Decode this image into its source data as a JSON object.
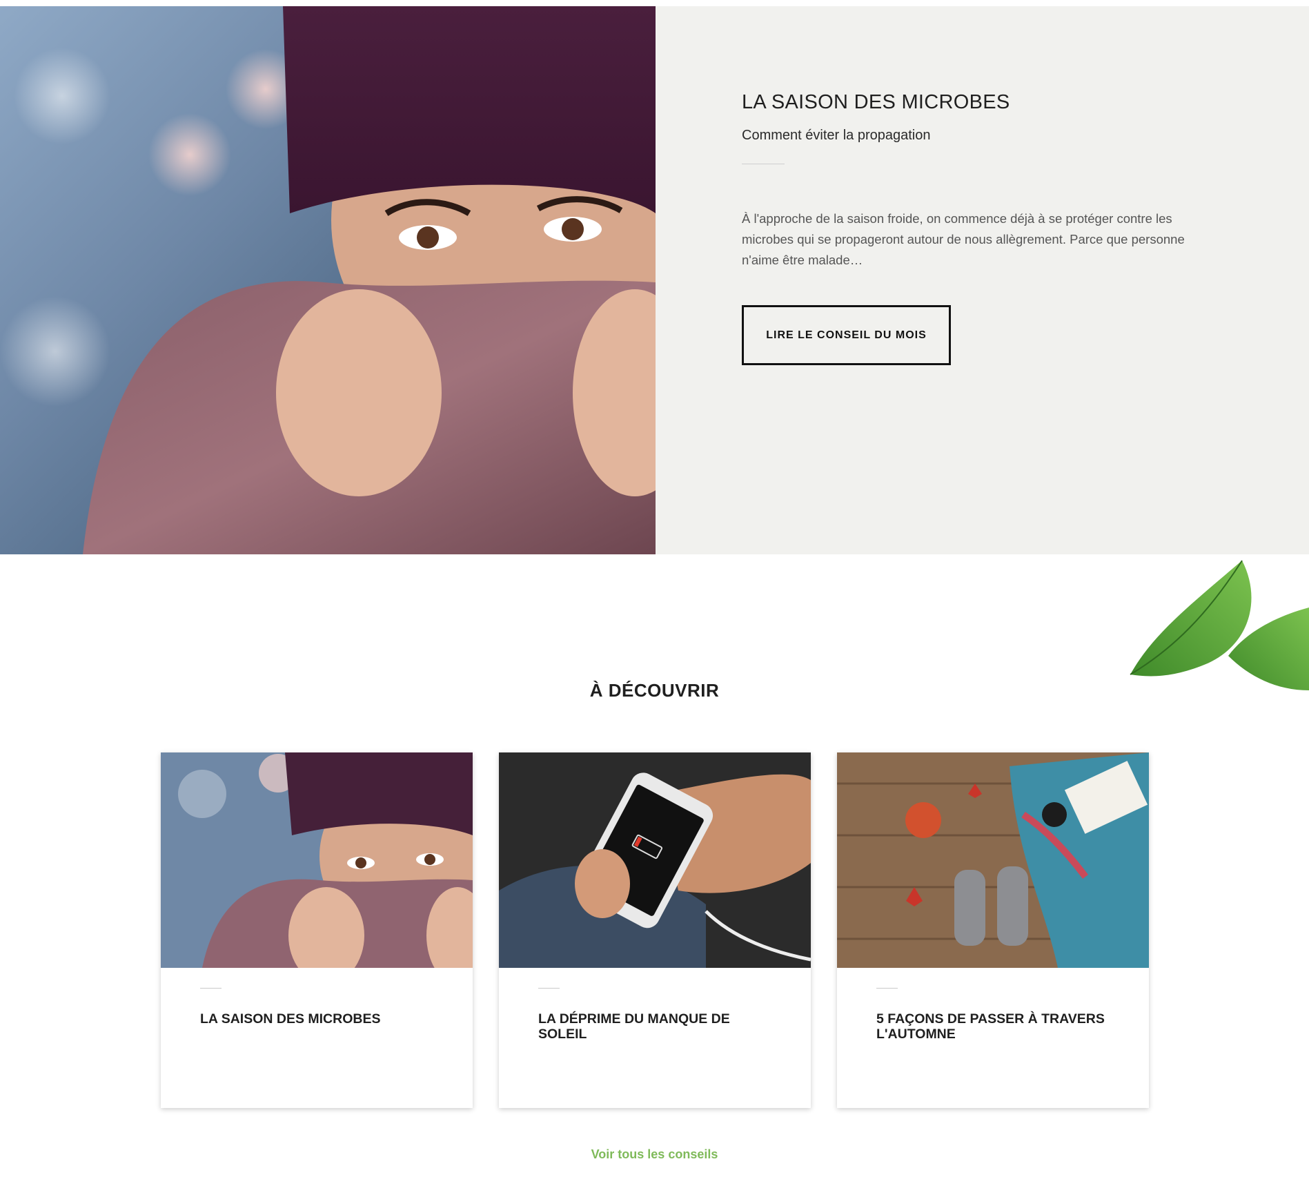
{
  "hero": {
    "title": "LA SAISON DES MICROBES",
    "subtitle": "Comment éviter la propagation",
    "body": "À l'approche de la saison froide, on commence déjà à se protéger contre les microbes qui se propageront autour de nous allègrement. Parce que personne n'aime être malade…",
    "button_label": "LIRE LE CONSEIL DU MOIS",
    "image": "woman-in-purple-beanie-and-scarf-photo"
  },
  "discover": {
    "title": "À DÉCOUVRIR",
    "cards": [
      {
        "title": "LA SAISON DES MICROBES",
        "image": "woman-in-scarf-photo"
      },
      {
        "title": "LA DÉPRIME DU MANQUE DE SOLEIL",
        "image": "phone-low-battery-photo"
      },
      {
        "title": "5 FAÇONS DE PASSER À TRAVERS L'AUTOMNE",
        "image": "autumn-socks-pumpkin-photo"
      }
    ],
    "more_link": "Voir tous les conseils"
  },
  "colors": {
    "panel_bg": "#f1f1ee",
    "accent_green": "#7fba5a",
    "text_dark": "#1f1f1f"
  }
}
